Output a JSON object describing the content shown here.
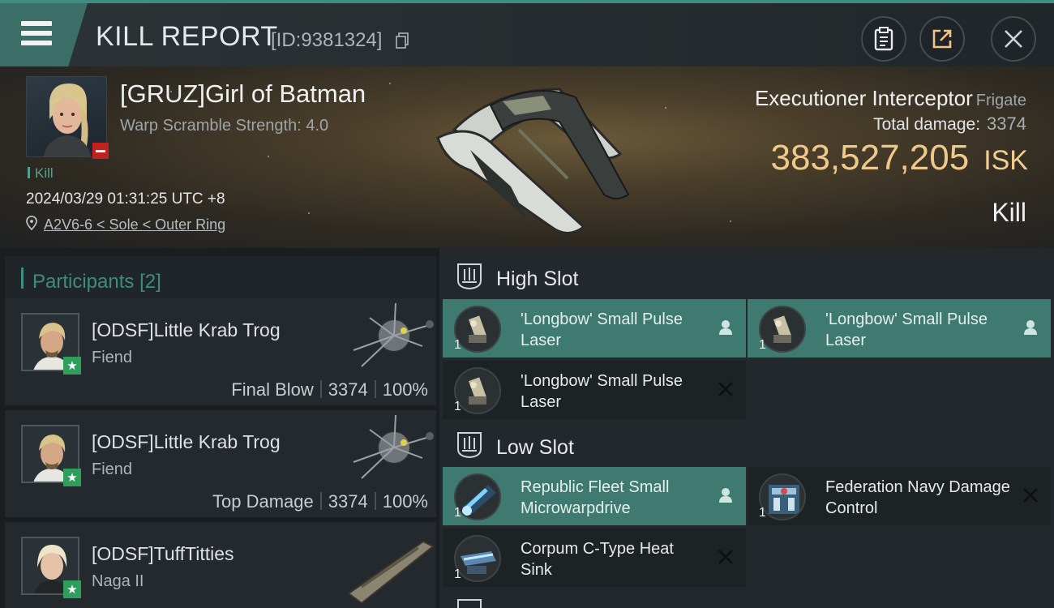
{
  "header": {
    "title": "KILL REPORT",
    "report_id": "[ID:9381324]"
  },
  "victim": {
    "name": "[GRUZ]Girl of Batman",
    "warp_scramble": "Warp Scramble Strength: 4.0",
    "tag": "Kill",
    "time": "2024/03/29 01:31:25 UTC +8",
    "location": "A2V6-6 < Sole < Outer Ring",
    "ship_name": "Executioner Interceptor",
    "ship_class": "Frigate",
    "total_damage_label": "Total damage:",
    "total_damage": "3374",
    "isk_value": "383,527,205",
    "isk_unit": "ISK",
    "result": "Kill"
  },
  "participants": {
    "title": "Participants",
    "count": "[2]",
    "rows": [
      {
        "name": "[ODSF]Little Krab Trog",
        "ship": "Fiend",
        "role": "Final Blow",
        "damage": "3374",
        "percent": "100%"
      },
      {
        "name": "[ODSF]Little Krab Trog",
        "ship": "Fiend",
        "role": "Top Damage",
        "damage": "3374",
        "percent": "100%"
      },
      {
        "name": "[ODSF]TuffTitties",
        "ship": "Naga II",
        "role": "",
        "damage": "",
        "percent": ""
      }
    ]
  },
  "slots": {
    "high": {
      "title": "High Slot",
      "modules": [
        {
          "name": "'Longbow' Small Pulse Laser",
          "qty": "1",
          "state": "equipped"
        },
        {
          "name": "'Longbow' Small Pulse Laser",
          "qty": "1",
          "state": "equipped"
        },
        {
          "name": "'Longbow' Small Pulse Laser",
          "qty": "1",
          "state": "destroyed"
        }
      ]
    },
    "low": {
      "title": "Low Slot",
      "modules": [
        {
          "name": "Republic Fleet Small Microwarpdrive",
          "qty": "1",
          "state": "equipped"
        },
        {
          "name": "Federation Navy Damage Control",
          "qty": "1",
          "state": "destroyed"
        },
        {
          "name": "Corpum C-Type Heat Sink",
          "qty": "1",
          "state": "destroyed"
        }
      ]
    }
  },
  "colors": {
    "accent": "#3f8c80",
    "isk": "#efc98a",
    "equipped_bg": "#3f7a70"
  }
}
